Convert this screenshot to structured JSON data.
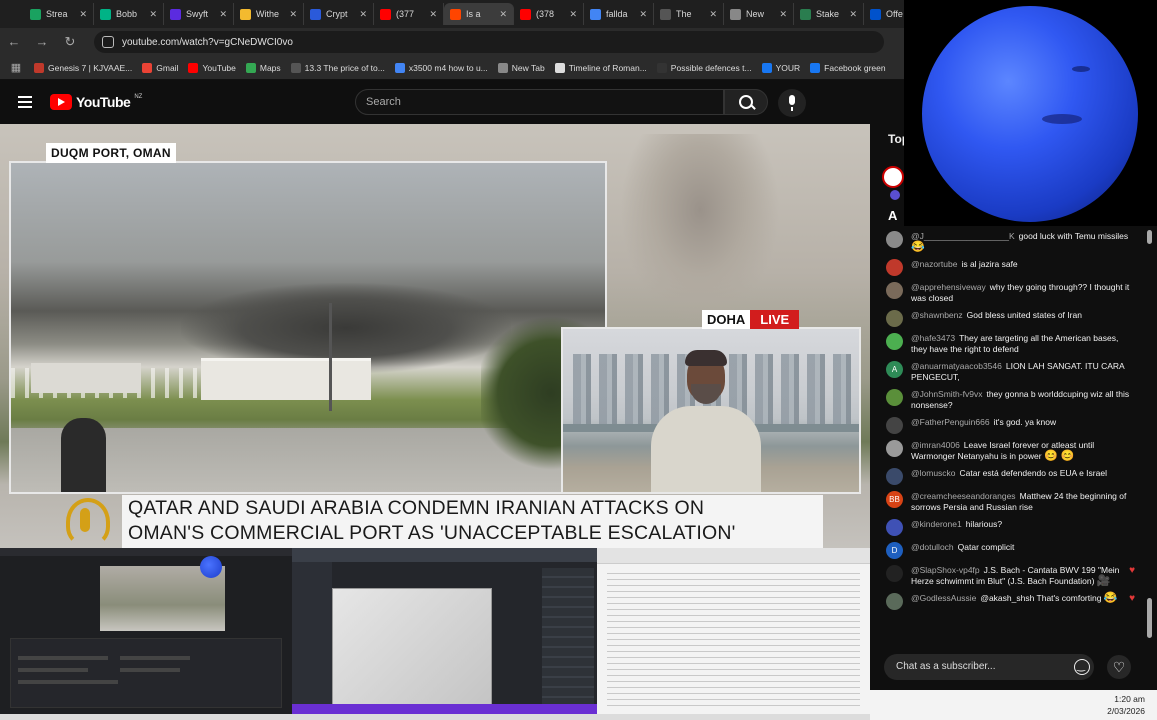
{
  "browser": {
    "tabs": [
      {
        "label": "Strea",
        "color": "#1aa260",
        "active": false
      },
      {
        "label": "Bobb",
        "color": "#00b386",
        "active": false
      },
      {
        "label": "Swyft",
        "color": "#5b2be0",
        "active": false
      },
      {
        "label": "Withe",
        "color": "#f3ba2f",
        "active": false
      },
      {
        "label": "Crypt",
        "color": "#2a5ada",
        "active": false
      },
      {
        "label": "(377",
        "color": "#ff0000",
        "active": false
      },
      {
        "label": "Is a",
        "color": "#ff4500",
        "active": true
      },
      {
        "label": "(378",
        "color": "#ff0000",
        "active": false
      },
      {
        "label": "fallda",
        "color": "#4285f4",
        "active": false
      },
      {
        "label": "The",
        "color": "#555555",
        "active": false
      },
      {
        "label": "New",
        "color": "#888888",
        "active": false
      },
      {
        "label": "Stake",
        "color": "#2a7d4f",
        "active": false
      },
      {
        "label": "Offe",
        "color": "#0052cc",
        "active": false
      }
    ],
    "url": "youtube.com/watch?v=gCNeDWCI0vo",
    "bookmarks": [
      {
        "label": "Genesis 7 | KJVAAE...",
        "color": "#c0392b"
      },
      {
        "label": "Gmail",
        "color": "#ea4335"
      },
      {
        "label": "YouTube",
        "color": "#ff0000"
      },
      {
        "label": "Maps",
        "color": "#34a853"
      },
      {
        "label": "13.3 The price of to...",
        "color": "#555555"
      },
      {
        "label": "x3500 m4 how to u...",
        "color": "#4285f4"
      },
      {
        "label": "New Tab",
        "color": "#888888"
      },
      {
        "label": "Timeline of Roman...",
        "color": "#dddddd"
      },
      {
        "label": "Possible defences t...",
        "color": "#333333"
      },
      {
        "label": "YOUR",
        "color": "#1877f2"
      },
      {
        "label": "Facebook green",
        "color": "#1877f2"
      }
    ]
  },
  "youtube": {
    "logo_text": "YouTube",
    "country_code": "NZ",
    "search_placeholder": "Search"
  },
  "video": {
    "location_label": "DUQM PORT, OMAN",
    "inset_city": "DOHA",
    "inset_live": "LIVE",
    "headline_line1": "QATAR AND SAUDI ARABIA CONDEMN IRANIAN ATTACKS ON",
    "headline_line2": "OMAN'S COMMERCIAL PORT AS 'UNACCEPTABLE ESCALATION'"
  },
  "chat": {
    "header": "Top",
    "pinned_initial": "A",
    "input_placeholder": "Chat as a subscriber...",
    "messages": [
      {
        "author": "@J__________________K",
        "text": "good luck with Temu missiles",
        "emoji": "😂",
        "avatar_color": "#8a8a8a",
        "avatar_letter": "",
        "heart": false
      },
      {
        "author": "@nazortube",
        "text": "is al jazira safe",
        "emoji": "",
        "avatar_color": "#c0392b",
        "avatar_letter": "",
        "heart": false
      },
      {
        "author": "@apprehensiveway",
        "text": "why they going through?? I thought it was closed",
        "emoji": "",
        "avatar_color": "#7a6a5a",
        "avatar_letter": "",
        "heart": false
      },
      {
        "author": "@shawnbenz",
        "text": "God bless united states of Iran",
        "emoji": "",
        "avatar_color": "#6b6b4a",
        "avatar_letter": "",
        "heart": false
      },
      {
        "author": "@hafe3473",
        "text": "They are targeting all the American bases, they have the right to defend",
        "emoji": "",
        "avatar_color": "#4caf50",
        "avatar_letter": "",
        "heart": false
      },
      {
        "author": "@anuarmatyaacob3546",
        "text": "LION LAH SANGAT. ITU CARA PENGECUT,",
        "emoji": "",
        "avatar_color": "#2e8b57",
        "avatar_letter": "A",
        "heart": false
      },
      {
        "author": "@JohnSmith-fv9vx",
        "text": "they gonna b worlddcuping wiz all this nonsense?",
        "emoji": "",
        "avatar_color": "#5a8f3a",
        "avatar_letter": "",
        "heart": false
      },
      {
        "author": "@FatherPenguin666",
        "text": "it's god. ya know",
        "emoji": "",
        "avatar_color": "#444444",
        "avatar_letter": "",
        "heart": false
      },
      {
        "author": "@imran4006",
        "text": "Leave Israel forever or atleast until Warmonger Netanyahu is in power",
        "emoji": "😊 😊",
        "avatar_color": "#9a9a9a",
        "avatar_letter": "",
        "heart": false
      },
      {
        "author": "@lomuscko",
        "text": "Catar está defendendo os EUA e Israel",
        "emoji": "",
        "avatar_color": "#3a4a6a",
        "avatar_letter": "",
        "heart": false
      },
      {
        "author": "@creamcheeseandoranges",
        "text": "Matthew 24 the beginning of sorrows Persia and Russian rise",
        "emoji": "",
        "avatar_color": "#d84315",
        "avatar_letter": "BB",
        "heart": false
      },
      {
        "author": "@kinderone1",
        "text": "hilarious?",
        "emoji": "",
        "avatar_color": "#3f51b5",
        "avatar_letter": "",
        "heart": false
      },
      {
        "author": "@dotulloch",
        "text": "Qatar complicit",
        "emoji": "",
        "avatar_color": "#1e5fbf",
        "avatar_letter": "D",
        "heart": false
      },
      {
        "author": "@SlapShox-vp4fp",
        "text": "J.S. Bach - Cantata BWV 199 \"Mein Herze schwimmt im Blut\" (J.S. Bach Foundation)",
        "emoji": "🎥",
        "avatar_color": "#222222",
        "avatar_letter": "",
        "heart": true
      },
      {
        "author": "@GodlessAussie",
        "text": "@akash_shsh That's comforting",
        "emoji": "😂",
        "avatar_color": "#5a6a5a",
        "avatar_letter": "",
        "heart": true
      }
    ]
  },
  "system": {
    "time": "1:20 am",
    "date": "2/03/2026"
  }
}
